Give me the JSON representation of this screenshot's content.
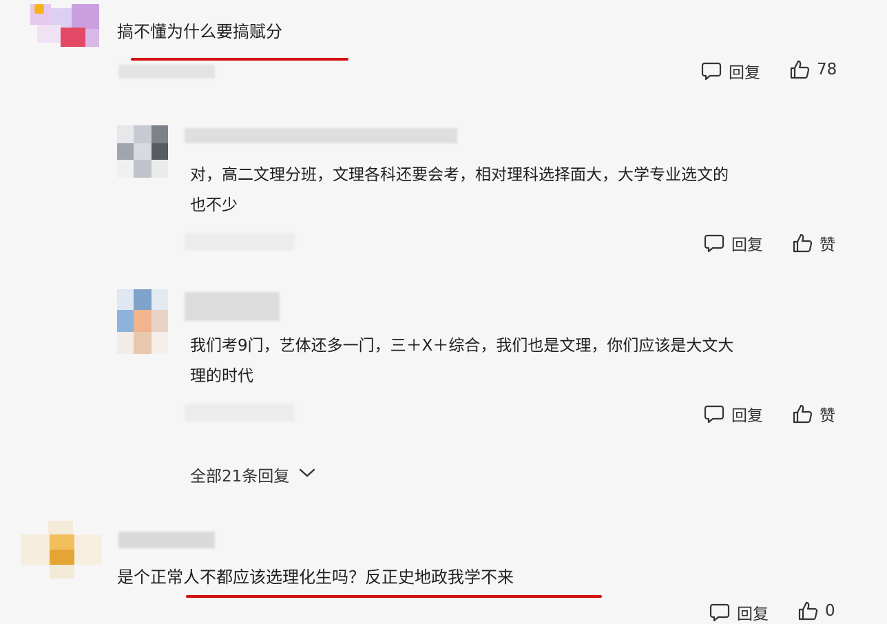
{
  "comments": [
    {
      "text": "搞不懂为什么要搞赋分",
      "reply_label": "回复",
      "like_label": "78"
    },
    {
      "text": "是个正常人不都应该选理化生吗？反正史地政我学不来",
      "reply_label": "回复",
      "like_label": "0"
    }
  ],
  "replies": [
    {
      "text_line1": "对，高二文理分班，文理各科还要会考，相对理科选择面大，大学专业选文的",
      "text_line2": "也不少",
      "reply_label": "回复",
      "like_label": "赞"
    },
    {
      "text_line1": "我们考9门，艺体还多一门，三＋X＋综合，我们也是文理，你们应该是大文大",
      "text_line2": "理的时代",
      "reply_label": "回复",
      "like_label": "赞"
    }
  ],
  "view_all_replies": "全部21条回复",
  "icons": {
    "reply": "comment-bubble-icon",
    "like": "thumbs-up-icon",
    "expand": "chevron-down-icon"
  },
  "colors": {
    "background": "#f6f6f6",
    "underline": "#d41010",
    "text": "#1f1f1f"
  }
}
